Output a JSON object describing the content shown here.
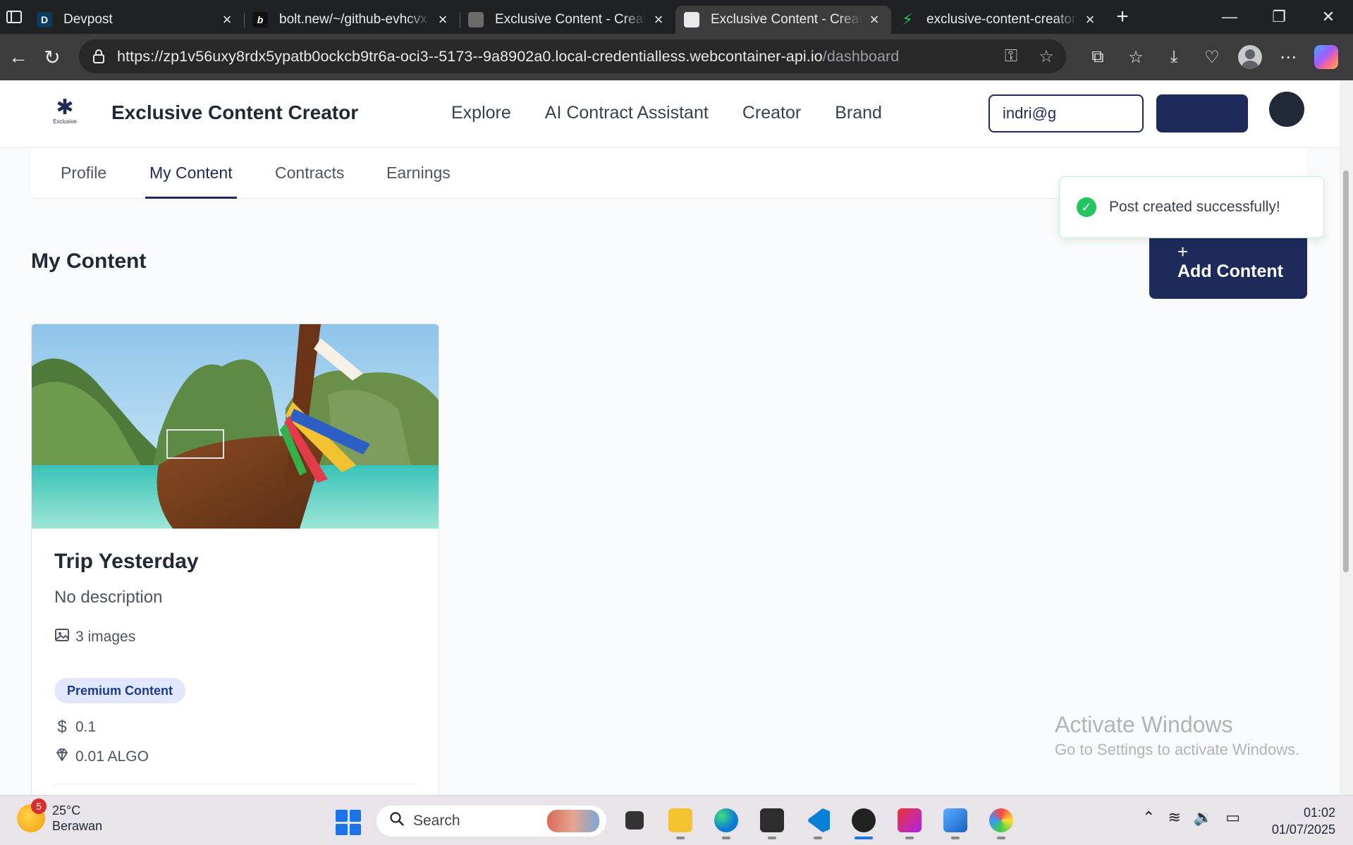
{
  "browser": {
    "tabs": [
      {
        "title": "Devpost",
        "favicon_letter": "D",
        "favicon_color": "#0b3c5d",
        "active": false
      },
      {
        "title": "bolt.new/~/github-evhcvx",
        "favicon_letter": "b",
        "favicon_color": "#111111",
        "active": false
      },
      {
        "title": "Exclusive Content - Creator",
        "favicon_letter": "",
        "favicon_color": "#9aa0a6",
        "active": false
      },
      {
        "title": "Exclusive Content - Creator",
        "favicon_letter": "",
        "favicon_color": "#e8eaed",
        "active": true
      },
      {
        "title": "exclusive-content-creator",
        "favicon_letter": "",
        "favicon_color": "#22c55e",
        "active": false
      }
    ],
    "url_host": "https://zp1v56uxy8rdx5ypatb0ockcb9tr6a-oci3--5173--9a8902a0.local-credentialless.webcontainer-api.io",
    "url_path": "/dashboard"
  },
  "app": {
    "brand": "Exclusive Content Creator",
    "logo_sub": "Exclusive",
    "nav": [
      "Explore",
      "AI Contract Assistant",
      "Creator",
      "Brand"
    ],
    "email": "indri@g"
  },
  "subtabs": [
    "Profile",
    "My Content",
    "Contracts",
    "Earnings"
  ],
  "active_subtab": "My Content",
  "section_title": "My Content",
  "add_button": {
    "icon": "+",
    "label": "Add Content"
  },
  "content_card": {
    "title": "Trip Yesterday",
    "description": "No description",
    "images": "3 images",
    "badge": "Premium Content",
    "price": "0.1",
    "algo": "0.01 ALGO"
  },
  "toast": "Post created successfully!",
  "watermark": {
    "line1": "Activate Windows",
    "line2": "Go to Settings to activate Windows."
  },
  "taskbar": {
    "weather_temp": "25°C",
    "weather_desc": "Berawan",
    "weather_badge": "5",
    "search_placeholder": "Search",
    "time": "01:02",
    "date": "01/07/2025"
  },
  "colors": {
    "brand_navy": "#1e2a5a",
    "success_green": "#22c55e",
    "badge_bg": "#e0e7ff"
  }
}
